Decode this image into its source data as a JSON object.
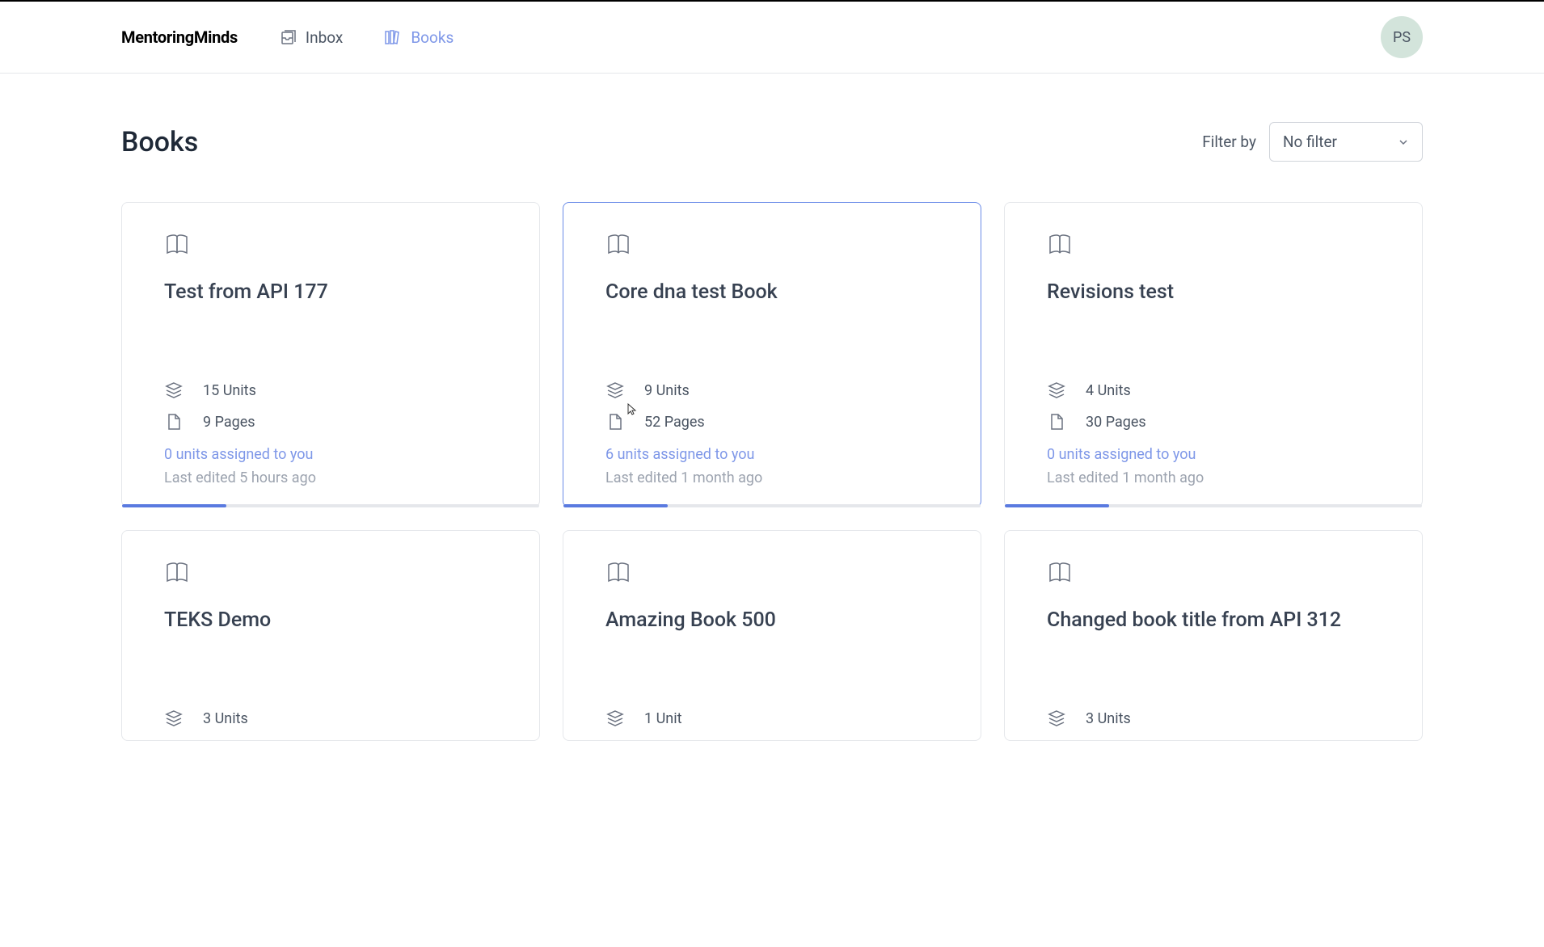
{
  "brand": "MentoringMinds",
  "nav": {
    "inbox": "Inbox",
    "books": "Books"
  },
  "avatar": "PS",
  "page": {
    "title": "Books",
    "filter_label": "Filter by",
    "filter_value": "No filter"
  },
  "books": [
    {
      "title": "Test from API 177",
      "units": "15 Units",
      "pages": "9 Pages",
      "assigned": "0 units assigned to you",
      "edited": "Last edited 5 hours ago",
      "progress": 25,
      "highlighted": false
    },
    {
      "title": "Core dna test Book",
      "units": "9 Units",
      "pages": "52 Pages",
      "assigned": "6 units assigned to you",
      "edited": "Last edited 1 month ago",
      "progress": 25,
      "highlighted": true
    },
    {
      "title": "Revisions test",
      "units": "4 Units",
      "pages": "30 Pages",
      "assigned": "0 units assigned to you",
      "edited": "Last edited 1 month ago",
      "progress": 25,
      "highlighted": false
    },
    {
      "title": "TEKS Demo",
      "units": "3 Units",
      "pages": "",
      "assigned": "",
      "edited": "",
      "progress": 0,
      "highlighted": false
    },
    {
      "title": "Amazing Book 500",
      "units": "1 Unit",
      "pages": "",
      "assigned": "",
      "edited": "",
      "progress": 0,
      "highlighted": false
    },
    {
      "title": "Changed book title from API 312",
      "units": "3 Units",
      "pages": "",
      "assigned": "",
      "edited": "",
      "progress": 0,
      "highlighted": false
    }
  ]
}
